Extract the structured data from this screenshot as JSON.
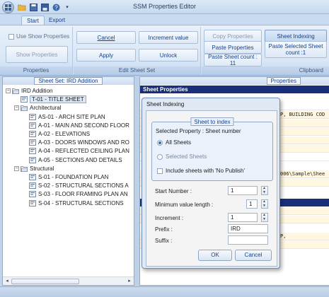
{
  "window": {
    "title": "SSM Properties Editor"
  },
  "tabs": [
    "Start",
    "Export"
  ],
  "ribbon": {
    "properties": {
      "use_show_properties": "Use Show Properties",
      "show_properties": "Show Properties",
      "label": "Properties"
    },
    "edit_sheet_set": {
      "cancel": "Cancel",
      "increment_value": "Increment value",
      "apply": "Apply",
      "unlock": "Unlock",
      "label": "Edit Sheet Set"
    },
    "clipboard": {
      "copy_properties": "Copy Properties",
      "paste_properties": "Paste Properties",
      "paste_sheet_count": "Paste Sheet count : 11",
      "sheet_indexing": "Sheet Indexing",
      "paste_selected_sheet": "Paste Selected Sheet count :1",
      "label": "Clipboard"
    }
  },
  "left_panel": {
    "caption": "Sheet Set: IRD Addition",
    "tree": [
      {
        "label": "IRD Addition",
        "level": 0,
        "type": "root",
        "expander": "−"
      },
      {
        "label": "T-01 - TITLE SHEET",
        "level": 1,
        "type": "sheet",
        "selected": true
      },
      {
        "label": "Architectural",
        "level": 1,
        "type": "folder",
        "expander": "−"
      },
      {
        "label": "AS-01 - ARCH SITE PLAN",
        "level": 2,
        "type": "sheet"
      },
      {
        "label": "A-01 - MAIN AND SECOND FLOOR",
        "level": 2,
        "type": "sheet"
      },
      {
        "label": "A-02 - ELEVATIONS",
        "level": 2,
        "type": "sheet"
      },
      {
        "label": "A-03 - DOORS WINDOWS AND RO",
        "level": 2,
        "type": "sheet"
      },
      {
        "label": "A-04 - REFLECTED CEILING PLAN",
        "level": 2,
        "type": "sheet"
      },
      {
        "label": "A-05 - SECTIONS AND DETAILS",
        "level": 2,
        "type": "sheet"
      },
      {
        "label": "Structural",
        "level": 1,
        "type": "folder",
        "expander": "−"
      },
      {
        "label": "S-01 - FOUNDATION PLAN",
        "level": 2,
        "type": "sheet"
      },
      {
        "label": "S-02 - STRUCTURAL SECTIONS A",
        "level": 2,
        "type": "sheet"
      },
      {
        "label": "S-03 - FLOOR FRAMING PLAN AN",
        "level": 2,
        "type": "sheet"
      },
      {
        "label": "S-04 - STRUCTURAL SECTIONS",
        "level": 2,
        "type": "sheet"
      }
    ]
  },
  "right_panel": {
    "caption": "Properties",
    "header": "Sheet Properties",
    "visible_values": [
      "P, BUILDING COD",
      "006\\Sample\\Shee",
      "P,"
    ]
  },
  "dialog": {
    "title": "Sheet Indexing",
    "group_title": "Sheet to index",
    "selected_property": "Selected Property : Sheet number",
    "option_all": "All Sheets",
    "option_selected": "Selected Sheets",
    "include_no_publish": "Include sheets with 'No Publish'",
    "start_number_label": "Start Number :",
    "start_number_value": "1",
    "min_length_label": "Minimum value length :",
    "min_length_value": "1",
    "increment_label": "Increment :",
    "increment_value": "1",
    "prefix_label": "Prefix :",
    "prefix_value": "IRD",
    "suffix_label": "Suffix :",
    "suffix_value": "",
    "ok": "OK",
    "cancel": "Cancel"
  },
  "colors": {
    "accent": "#15428b",
    "header_band": "#1a2f7a",
    "ribbon_bg": "#d8e6f6"
  }
}
